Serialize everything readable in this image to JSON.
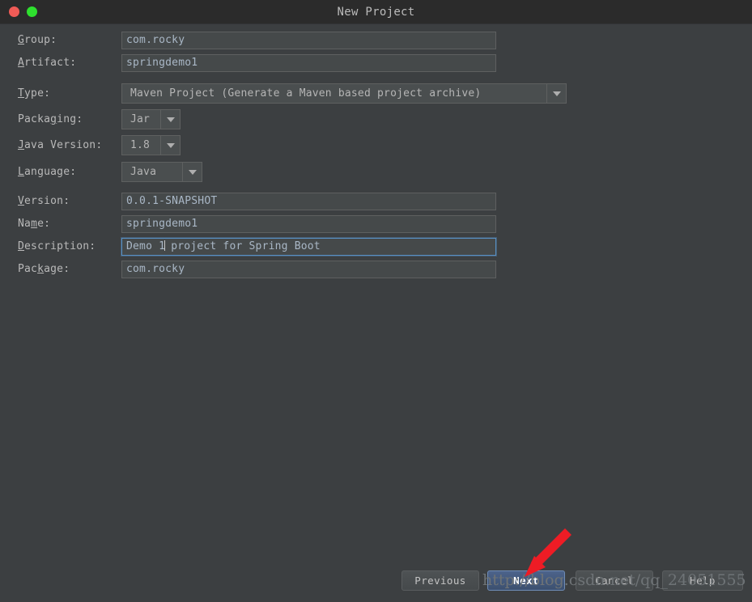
{
  "window": {
    "title": "New Project",
    "controls": [
      {
        "name": "close-button",
        "color": "#f05b56"
      },
      {
        "name": "zoom-button",
        "color": "#2ee02e"
      }
    ]
  },
  "form": {
    "fields": [
      {
        "id": "group",
        "label": "Group:",
        "mnemonic": "G",
        "type": "text",
        "value": "com.rocky",
        "focused": false
      },
      {
        "id": "artifact",
        "label": "Artifact:",
        "mnemonic": "A",
        "type": "text",
        "value": "springdemo1",
        "focused": false
      },
      {
        "id": "type",
        "label": "Type:",
        "mnemonic": "T",
        "type": "combo",
        "value": "Maven Project (Generate a Maven based project archive)",
        "focused": false
      },
      {
        "id": "packaging",
        "label": "Packaging:",
        "mnemonic": "g",
        "type": "combo",
        "value": "Jar",
        "focused": false
      },
      {
        "id": "java-version",
        "label": "Java Version:",
        "mnemonic": "J",
        "type": "combo",
        "value": "1.8",
        "focused": false
      },
      {
        "id": "language",
        "label": "Language:",
        "mnemonic": "L",
        "type": "combo",
        "value": "Java",
        "focused": false
      },
      {
        "id": "version",
        "label": "Version:",
        "mnemonic": "V",
        "type": "text",
        "value": "0.0.1-SNAPSHOT",
        "focused": false
      },
      {
        "id": "name",
        "label": "Name:",
        "mnemonic": "m",
        "type": "text",
        "value": "springdemo1",
        "focused": false
      },
      {
        "id": "description",
        "label": "Description:",
        "mnemonic": "D",
        "type": "text",
        "value_before_caret": "Demo 1",
        "value_after_caret": " project for Spring Boot",
        "value": "Demo 1 project for Spring Boot",
        "focused": true
      },
      {
        "id": "package",
        "label": "Package:",
        "mnemonic": "k",
        "type": "text",
        "value": "com.rocky",
        "focused": false
      }
    ]
  },
  "buttons": {
    "previous": "Previous",
    "next": "Next",
    "cancel": "Cancel",
    "help": "Help"
  },
  "annotation": {
    "arrow": "red-arrow-pointing-to-next-button",
    "arrow_color": "#ee1c25"
  },
  "watermark": {
    "text": "http://blog.csdn.net/qq_24051555"
  },
  "colors": {
    "window_background": "#3c3f41",
    "titlebar_background": "#2b2b2b",
    "field_background": "#45494a",
    "field_border": "#5e6060",
    "focus_border": "#5890c4",
    "text": "#b9b9b9",
    "value_text": "#a9b7c6",
    "default_button": "#44597c"
  }
}
